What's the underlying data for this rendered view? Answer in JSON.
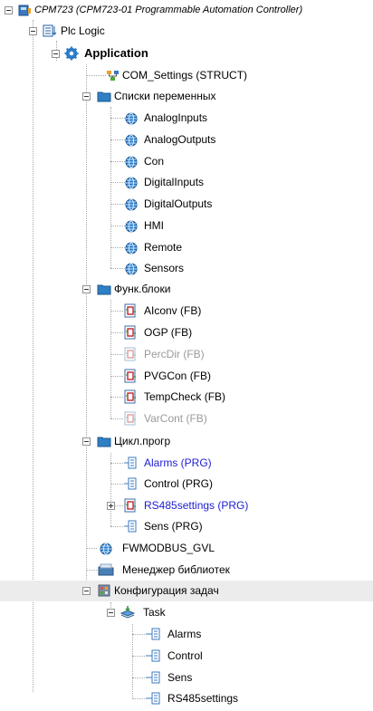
{
  "tree": {
    "device": "CPM723 (CPM723-01 Programmable Automation Controller)",
    "plc_logic": "Plc Logic",
    "application": "Application",
    "com_settings": "COM_Settings (STRUCT)",
    "var_lists": {
      "label": "Списки переменных",
      "items": [
        "AnalogInputs",
        "AnalogOutputs",
        "Con",
        "DigitalInputs",
        "DigitalOutputs",
        "HMI",
        "Remote",
        "Sensors"
      ]
    },
    "func_blocks": {
      "label": "Функ.блоки",
      "items": [
        "AIconv (FB)",
        "OGP (FB)",
        "PercDir (FB)",
        "PVGCon (FB)",
        "TempCheck (FB)",
        "VarCont (FB)"
      ]
    },
    "cyclic": {
      "label": "Цикл.прогр",
      "items": [
        "Alarms (PRG)",
        "Control (PRG)",
        "RS485settings (PRG)",
        "Sens (PRG)"
      ]
    },
    "fwmodbus": "FWMODBUS_GVL",
    "library_manager": "Менеджер библиотек",
    "task_config": "Конфигурация задач",
    "task": "Task",
    "task_calls": [
      "Alarms",
      "Control",
      "Sens",
      "RS485settings"
    ]
  },
  "colors": {
    "selected_row": "#ececec",
    "link_blue": "#1c1cd4",
    "disabled_grey": "#9a9a9a",
    "folder_blue": "#2f7fc4",
    "globe_blue": "#1f77c9"
  }
}
